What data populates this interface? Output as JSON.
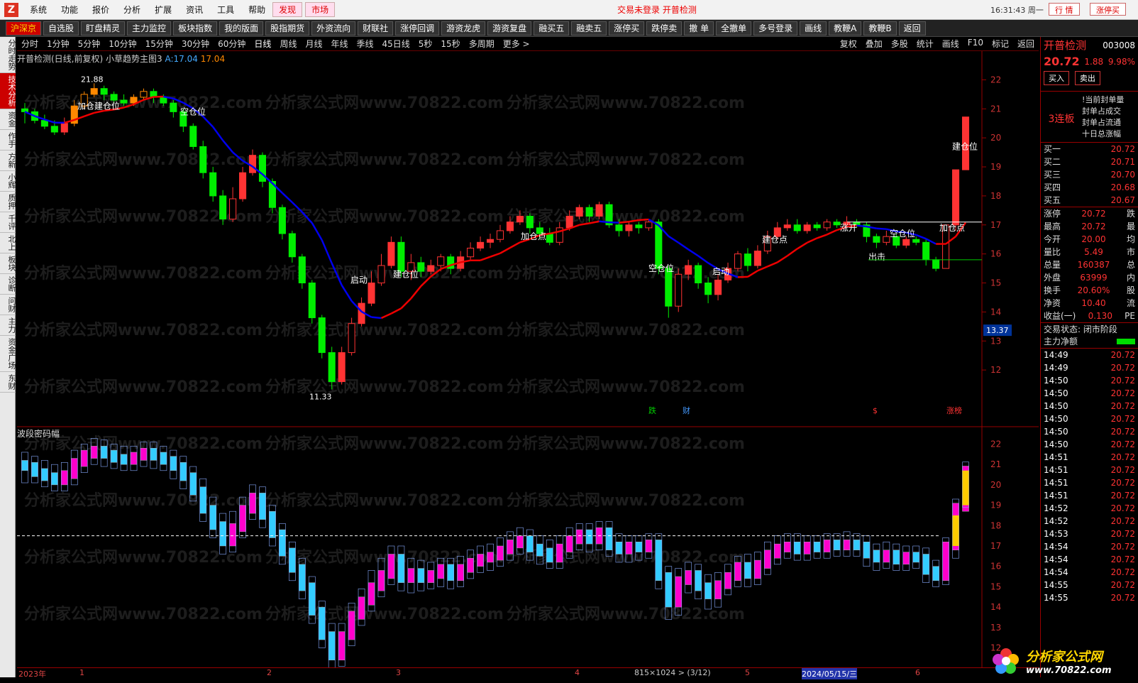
{
  "menubar": {
    "items": [
      "系统",
      "功能",
      "报价",
      "分析",
      "扩展",
      "资讯",
      "工具",
      "帮助"
    ],
    "tabs": [
      "发现",
      "市场"
    ],
    "status": "交易未登录  开普检测",
    "time": "16:31:43 周一",
    "buttons": [
      "行 情",
      "涨停买"
    ]
  },
  "toolbar": {
    "items": [
      "沪深京",
      "自选股",
      "盯盘精灵",
      "主力监控",
      "板块指数",
      "我的版面",
      "股指期货",
      "外资流向",
      "财联社",
      "涨停回调",
      "游资龙虎",
      "游资复盘",
      "融买五",
      "融卖五",
      "涨停买",
      "跌停卖",
      "撤 单",
      "全撤单",
      "多号登录",
      "画线",
      "教鞭A",
      "教鞭B",
      "返回"
    ]
  },
  "lefttabs": [
    "分时走势",
    "技术分析",
    "资金",
    "作手",
    "方新",
    "小辉",
    "质押",
    "千评",
    "北上",
    "板块",
    "诊断",
    "问财",
    "主力",
    "资金广场",
    "东财"
  ],
  "periodbar": {
    "items": [
      "分时",
      "1分钟",
      "5分钟",
      "10分钟",
      "15分钟",
      "30分钟",
      "60分钟",
      "日线",
      "周线",
      "月线",
      "年线",
      "季线",
      "45日线",
      "5秒",
      "15秒",
      "多周期",
      "更多 >"
    ],
    "right": [
      "复权",
      "叠加",
      "多股",
      "统计",
      "画线",
      "F10",
      "标记",
      "返回"
    ]
  },
  "charttitle": {
    "stock": "开普检测(日线,前复权)",
    "indicator": "小草趋势主图3",
    "a_label": "A:17.04",
    "b_label": "17.04"
  },
  "subtitle": "波段密码幅",
  "chart_data": {
    "type": "candlestick",
    "price_axis": [
      22.0,
      21.0,
      20.0,
      19.0,
      18.0,
      17.0,
      16.0,
      15.0,
      14.0,
      13.0,
      12.0
    ],
    "price_range": [
      11.0,
      22.5
    ],
    "current_tag": "13.37",
    "high_label": "21.88",
    "low_label": "11.33",
    "time_axis": [
      "2023年",
      "1",
      "2",
      "3",
      "4",
      "5",
      "2024/05/15/三",
      "6"
    ],
    "annotations": [
      "加仓建仓位",
      "空仓位",
      "启动",
      "建仓位",
      "加仓点",
      "空仓位",
      "启动",
      "建仓点",
      "涨开",
      "空仓位",
      "出击",
      "加仓点",
      "建仓位"
    ],
    "bottom_marks": [
      "跌",
      "财",
      "$",
      "涨榜"
    ],
    "sub_axis": [
      22.0,
      21.0,
      20.0,
      19.0,
      18.0,
      17.0,
      16.0,
      15.0,
      14.0,
      13.0,
      12.0
    ],
    "candles": [
      [
        21.0,
        20.9,
        21.2,
        20.5
      ],
      [
        20.9,
        20.6,
        21.0,
        20.5
      ],
      [
        20.6,
        20.4,
        20.8,
        20.3
      ],
      [
        20.4,
        20.2,
        20.6,
        20.1
      ],
      [
        20.2,
        20.5,
        20.7,
        20.1
      ],
      [
        20.5,
        21.1,
        21.3,
        20.4
      ],
      [
        21.1,
        21.5,
        21.6,
        21.0
      ],
      [
        21.5,
        21.7,
        21.88,
        21.4
      ],
      [
        21.7,
        21.5,
        21.8,
        21.3
      ],
      [
        21.5,
        21.3,
        21.6,
        21.2
      ],
      [
        21.3,
        21.2,
        21.5,
        21.1
      ],
      [
        21.2,
        21.4,
        21.5,
        21.1
      ],
      [
        21.4,
        21.6,
        21.7,
        21.3
      ],
      [
        21.6,
        21.4,
        21.7,
        21.2
      ],
      [
        21.4,
        21.2,
        21.5,
        21.1
      ],
      [
        21.2,
        20.9,
        21.3,
        20.7
      ],
      [
        20.9,
        20.4,
        21.0,
        20.2
      ],
      [
        20.4,
        19.7,
        20.5,
        19.6
      ],
      [
        19.7,
        18.8,
        19.9,
        18.6
      ],
      [
        18.8,
        18.0,
        19.0,
        17.8
      ],
      [
        18.0,
        17.2,
        18.2,
        17.0
      ],
      [
        17.2,
        17.9,
        18.3,
        17.1
      ],
      [
        17.9,
        18.8,
        19.0,
        17.8
      ],
      [
        18.8,
        19.4,
        19.6,
        18.7
      ],
      [
        19.4,
        18.5,
        19.5,
        18.3
      ],
      [
        18.5,
        17.6,
        18.6,
        17.4
      ],
      [
        17.6,
        16.7,
        17.7,
        16.5
      ],
      [
        16.7,
        15.9,
        16.8,
        15.7
      ],
      [
        15.9,
        15.0,
        16.0,
        14.8
      ],
      [
        15.0,
        13.8,
        15.1,
        13.6
      ],
      [
        13.8,
        12.6,
        13.9,
        12.4
      ],
      [
        12.6,
        11.6,
        12.8,
        11.33
      ],
      [
        11.6,
        12.6,
        12.8,
        11.5
      ],
      [
        12.6,
        13.6,
        13.8,
        12.5
      ],
      [
        13.6,
        14.3,
        14.5,
        13.5
      ],
      [
        14.3,
        15.0,
        15.4,
        14.2
      ],
      [
        15.0,
        15.6,
        16.0,
        14.9
      ],
      [
        15.6,
        16.4,
        16.6,
        15.5
      ],
      [
        16.4,
        15.4,
        16.6,
        15.2
      ],
      [
        15.4,
        15.7,
        16.0,
        15.1
      ],
      [
        15.7,
        15.4,
        15.9,
        15.2
      ],
      [
        15.4,
        15.6,
        15.8,
        15.3
      ],
      [
        15.6,
        15.9,
        16.0,
        15.4
      ],
      [
        15.9,
        15.5,
        16.0,
        15.3
      ],
      [
        15.5,
        15.9,
        16.1,
        15.4
      ],
      [
        15.9,
        16.2,
        16.4,
        15.8
      ],
      [
        16.2,
        16.4,
        16.6,
        16.1
      ],
      [
        16.4,
        16.5,
        16.7,
        16.2
      ],
      [
        16.5,
        16.8,
        17.0,
        16.4
      ],
      [
        16.8,
        17.1,
        17.3,
        16.7
      ],
      [
        17.1,
        17.3,
        17.5,
        17.0
      ],
      [
        17.3,
        16.9,
        17.4,
        16.7
      ],
      [
        16.9,
        16.7,
        17.1,
        16.5
      ],
      [
        16.7,
        16.4,
        16.9,
        16.3
      ],
      [
        16.4,
        16.9,
        17.1,
        16.3
      ],
      [
        16.9,
        17.3,
        17.5,
        16.8
      ],
      [
        17.3,
        17.6,
        17.7,
        17.2
      ],
      [
        17.6,
        17.3,
        17.7,
        17.1
      ],
      [
        17.3,
        17.7,
        17.8,
        17.2
      ],
      [
        17.7,
        17.0,
        17.8,
        16.9
      ],
      [
        17.0,
        16.8,
        17.2,
        16.6
      ],
      [
        16.8,
        17.0,
        17.1,
        16.6
      ],
      [
        17.0,
        16.9,
        17.1,
        16.7
      ],
      [
        16.9,
        17.1,
        17.2,
        16.8
      ],
      [
        17.1,
        15.5,
        17.2,
        15.3
      ],
      [
        15.5,
        14.2,
        15.6,
        13.8
      ],
      [
        14.2,
        15.3,
        15.5,
        14.0
      ],
      [
        15.3,
        15.6,
        15.8,
        15.1
      ],
      [
        15.6,
        15.0,
        15.7,
        14.8
      ],
      [
        15.0,
        14.6,
        15.2,
        14.3
      ],
      [
        14.6,
        15.1,
        15.3,
        14.4
      ],
      [
        15.1,
        15.5,
        15.7,
        15.0
      ],
      [
        15.5,
        16.0,
        16.1,
        15.4
      ],
      [
        16.0,
        15.6,
        16.2,
        15.4
      ],
      [
        15.6,
        16.1,
        16.3,
        15.5
      ],
      [
        16.1,
        16.6,
        16.8,
        16.0
      ],
      [
        16.6,
        16.9,
        17.1,
        16.5
      ],
      [
        16.9,
        17.0,
        17.2,
        16.8
      ],
      [
        17.0,
        16.8,
        17.2,
        16.7
      ],
      [
        16.8,
        17.0,
        17.1,
        16.7
      ],
      [
        17.0,
        16.9,
        17.1,
        16.8
      ],
      [
        16.9,
        17.1,
        17.2,
        16.8
      ],
      [
        17.1,
        17.0,
        17.2,
        16.9
      ],
      [
        17.0,
        17.1,
        17.3,
        16.9
      ],
      [
        17.1,
        17.0,
        17.2,
        16.9
      ],
      [
        17.0,
        16.6,
        17.1,
        16.4
      ],
      [
        16.6,
        16.4,
        16.7,
        16.2
      ],
      [
        16.4,
        16.6,
        16.8,
        16.3
      ],
      [
        16.6,
        16.3,
        16.7,
        16.2
      ],
      [
        16.3,
        16.5,
        16.6,
        16.2
      ],
      [
        16.5,
        16.4,
        16.6,
        16.3
      ],
      [
        16.4,
        15.8,
        16.5,
        15.6
      ],
      [
        15.8,
        15.5,
        15.9,
        15.4
      ],
      [
        15.5,
        17.0,
        17.0,
        15.5
      ],
      [
        17.0,
        18.9,
        18.9,
        16.8
      ],
      [
        18.9,
        20.72,
        20.72,
        19.3
      ]
    ]
  },
  "rightpanel": {
    "name": "开普检测",
    "code": "003008",
    "price": "20.72",
    "change": "1.88",
    "pct": "9.98%",
    "buy_btn": "买入",
    "sell_btn": "卖出",
    "board_tag": "3连板",
    "notes": [
      "!当前封单量",
      "封单占成交",
      "封单占流通",
      "十日总涨幅"
    ],
    "bids": [
      {
        "label": "买一",
        "value": "20.72"
      },
      {
        "label": "买二",
        "value": "20.71"
      },
      {
        "label": "买三",
        "value": "20.70"
      },
      {
        "label": "买四",
        "value": "20.68"
      },
      {
        "label": "买五",
        "value": "20.67"
      }
    ],
    "stats": [
      {
        "label": "涨停",
        "value": "20.72",
        "extra": "跌"
      },
      {
        "label": "最高",
        "value": "20.72",
        "extra": "最"
      },
      {
        "label": "今开",
        "value": "20.00",
        "extra": "均"
      },
      {
        "label": "量比",
        "value": "5.49",
        "extra": "市"
      },
      {
        "label": "总量",
        "value": "160387",
        "extra": "总"
      },
      {
        "label": "外盘",
        "value": "63999",
        "extra": "内"
      },
      {
        "label": "换手",
        "value": "20.60%",
        "extra": "股"
      },
      {
        "label": "净资",
        "value": "10.40",
        "extra": "流"
      },
      {
        "label": "收益(一)",
        "value": "0.130",
        "extra": "PE"
      }
    ],
    "trade_state": "交易状态: 闭市阶段",
    "main_net": "主力净额",
    "ticks": [
      {
        "time": "14:49",
        "price": "20.72"
      },
      {
        "time": "14:49",
        "price": "20.72"
      },
      {
        "time": "14:50",
        "price": "20.72"
      },
      {
        "time": "14:50",
        "price": "20.72"
      },
      {
        "time": "14:50",
        "price": "20.72"
      },
      {
        "time": "14:50",
        "price": "20.72"
      },
      {
        "time": "14:50",
        "price": "20.72"
      },
      {
        "time": "14:50",
        "price": "20.72"
      },
      {
        "time": "14:51",
        "price": "20.72"
      },
      {
        "time": "14:51",
        "price": "20.72"
      },
      {
        "time": "14:51",
        "price": "20.72"
      },
      {
        "time": "14:51",
        "price": "20.72"
      },
      {
        "time": "14:52",
        "price": "20.72"
      },
      {
        "time": "14:52",
        "price": "20.72"
      },
      {
        "time": "14:53",
        "price": "20.72"
      },
      {
        "time": "14:54",
        "price": "20.72"
      },
      {
        "time": "14:54",
        "price": "20.72"
      },
      {
        "time": "14:54",
        "price": "20.72"
      },
      {
        "time": "14:55",
        "price": "20.72"
      },
      {
        "time": "14:55",
        "price": "20.72"
      }
    ]
  },
  "bottombar": {
    "resolution": "815×1024 > (3/12)"
  },
  "brand": {
    "title": "分析家公式网",
    "url": "www.70822.com"
  },
  "watermark": "分析家公式网www.70822.com"
}
